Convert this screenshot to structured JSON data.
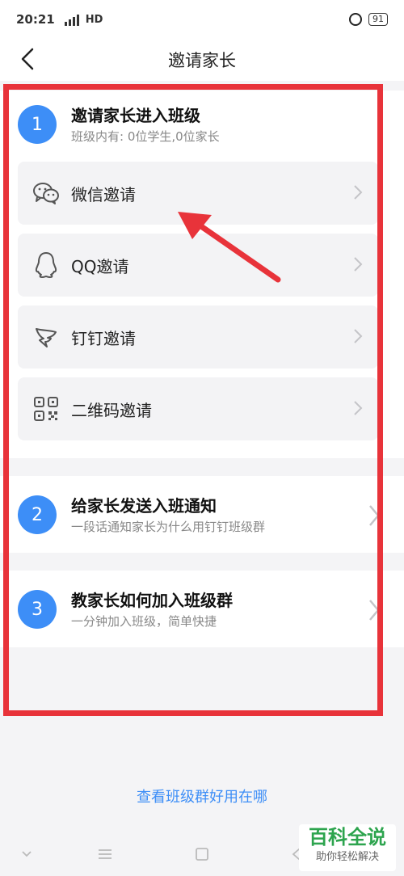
{
  "status_bar": {
    "time": "20:21",
    "network": "HD",
    "battery": "91"
  },
  "nav": {
    "title": "邀请家长"
  },
  "section1": {
    "number": "1",
    "title": "邀请家长进入班级",
    "subtitle": "班级内有: 0位学生,0位家长",
    "options": [
      {
        "label": "微信邀请",
        "icon": "wechat-icon"
      },
      {
        "label": "QQ邀请",
        "icon": "qq-icon"
      },
      {
        "label": "钉钉邀请",
        "icon": "dingtalk-icon"
      },
      {
        "label": "二维码邀请",
        "icon": "qr-code-icon"
      }
    ]
  },
  "section2": {
    "number": "2",
    "title": "给家长发送入班通知",
    "subtitle": "一段话通知家长为什么用钉钉班级群"
  },
  "section3": {
    "number": "3",
    "title": "教家长如何加入班级群",
    "subtitle": "一分钟加入班级，简单快捷"
  },
  "footer": {
    "link": "查看班级群好用在哪"
  },
  "watermark": {
    "logo": "百科全说",
    "sub": "助你轻松解决"
  },
  "colors": {
    "accent": "#3d8ef7",
    "highlight": "#e8333a"
  }
}
